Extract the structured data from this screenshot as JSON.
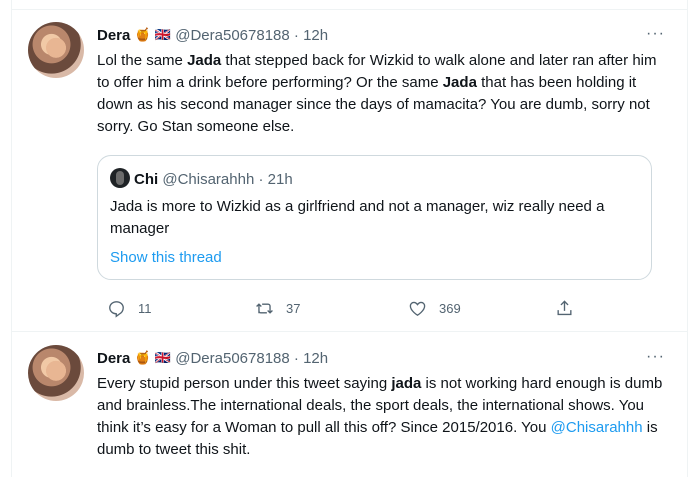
{
  "tweets": [
    {
      "name": "Dera",
      "emoji1": "🍯",
      "emoji2": "🇬🇧",
      "handle": "@Dera50678188",
      "separator": "·",
      "time": "12h",
      "more": "···",
      "text_parts": [
        "Lol the same ",
        "Jada",
        " that stepped back for Wizkid to walk alone and later ran after him to offer him a drink before performing? Or the same ",
        "Jada",
        " that has been holding it down as his second manager since the days of mamacita? You are dumb, sorry not sorry. Go Stan someone else."
      ],
      "quote": {
        "name": "Chi",
        "handle": "@Chisarahhh",
        "separator": "·",
        "time": "21h",
        "text": "Jada is more to Wizkid as a girlfriend and not a manager, wiz really need a manager",
        "show_thread": "Show this thread"
      },
      "actions": {
        "replies": "11",
        "retweets": "37",
        "likes": "369"
      }
    },
    {
      "name": "Dera",
      "emoji1": "🍯",
      "emoji2": "🇬🇧",
      "handle": "@Dera50678188",
      "separator": "·",
      "time": "12h",
      "more": "···",
      "text_parts": [
        "Every stupid person under this tweet saying ",
        "jada",
        " is not working hard enough is dumb and brainless.The international deals, the sport deals, the international shows. You think it’s easy for a Woman to pull all this off? Since 2015/2016. You ",
        "@Chisarahhh",
        " is dumb to tweet this shit."
      ]
    }
  ]
}
